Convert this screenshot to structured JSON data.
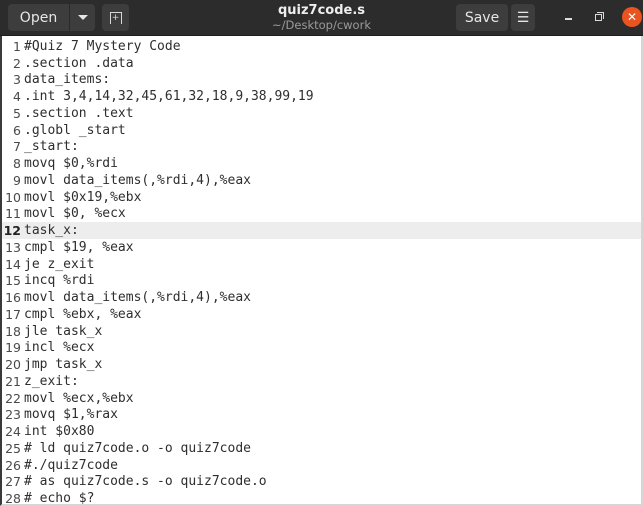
{
  "window": {
    "title": "quiz7code.s",
    "subtitle": "~/Desktop/cwork"
  },
  "headerbar": {
    "open_label": "Open",
    "open_menu_icon": "chevron-down-icon",
    "new_tab_icon": "new-tab-icon",
    "save_label": "Save",
    "menu_icon": "hamburger-menu-icon",
    "minimize_icon": "minimize-icon",
    "maximize_icon": "maximize-icon",
    "close_icon": "close-icon",
    "close_glyph": "✕",
    "menu_glyph": "☰",
    "accent_color": "#e95420"
  },
  "editor": {
    "current_line": 12,
    "lines": [
      {
        "n": "1",
        "text": "#Quiz 7 Mystery Code"
      },
      {
        "n": "2",
        "text": ".section .data"
      },
      {
        "n": "3",
        "text": "data_items:"
      },
      {
        "n": "4",
        "text": ".int 3,4,14,32,45,61,32,18,9,38,99,19"
      },
      {
        "n": "5",
        "text": ".section .text"
      },
      {
        "n": "6",
        "text": ".globl _start"
      },
      {
        "n": "7",
        "text": "_start:"
      },
      {
        "n": "8",
        "text": "movq $0,%rdi"
      },
      {
        "n": "9",
        "text": "movl data_items(,%rdi,4),%eax"
      },
      {
        "n": "10",
        "text": "movl $0x19,%ebx"
      },
      {
        "n": "11",
        "text": "movl $0, %ecx"
      },
      {
        "n": "12",
        "text": "task_x:"
      },
      {
        "n": "13",
        "text": "cmpl $19, %eax"
      },
      {
        "n": "14",
        "text": "je z_exit"
      },
      {
        "n": "15",
        "text": "incq %rdi"
      },
      {
        "n": "16",
        "text": "movl data_items(,%rdi,4),%eax"
      },
      {
        "n": "17",
        "text": "cmpl %ebx, %eax"
      },
      {
        "n": "18",
        "text": "jle task_x"
      },
      {
        "n": "19",
        "text": "incl %ecx"
      },
      {
        "n": "20",
        "text": "jmp task_x"
      },
      {
        "n": "21",
        "text": "z_exit:"
      },
      {
        "n": "22",
        "text": "movl %ecx,%ebx"
      },
      {
        "n": "23",
        "text": "movq $1,%rax"
      },
      {
        "n": "24",
        "text": "int $0x80"
      },
      {
        "n": "25",
        "text": "# ld quiz7code.o -o quiz7code"
      },
      {
        "n": "26",
        "text": "#./quiz7code"
      },
      {
        "n": "27",
        "text": "# as quiz7code.s -o quiz7code.o"
      },
      {
        "n": "28",
        "text": "# echo $?"
      }
    ]
  }
}
